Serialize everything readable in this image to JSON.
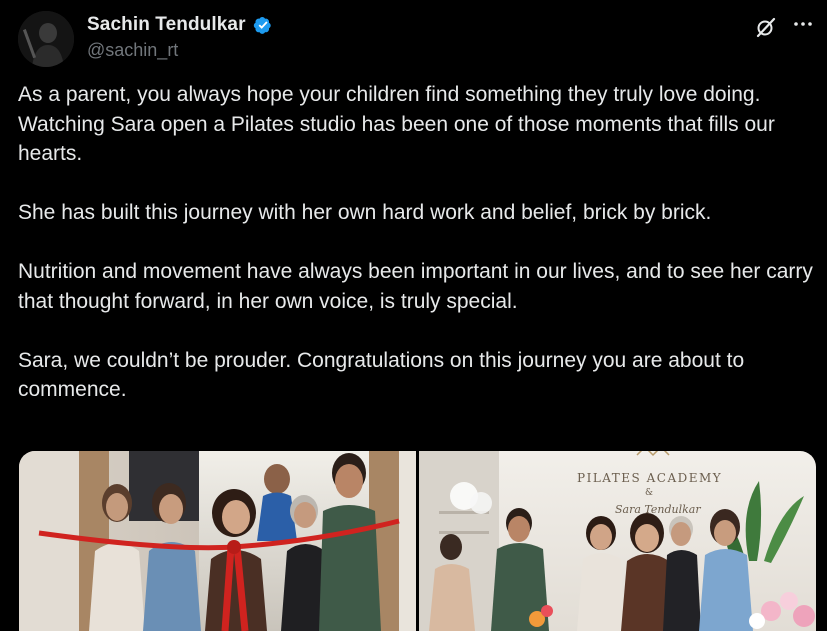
{
  "author": {
    "display_name": "Sachin Tendulkar",
    "handle": "@sachin_rt",
    "verified": true
  },
  "icons": {
    "avatar": "profile-avatar",
    "verified": "verified-badge-icon",
    "grok": "grok-icon",
    "more": "more-options-icon"
  },
  "colors": {
    "background": "#000000",
    "text": "#e7e9ea",
    "secondary_text": "#71767b",
    "verified_blue": "#1d9bf0"
  },
  "tweet": {
    "paragraphs": [
      "As a parent, you always hope your children find something they truly love doing. Watching Sara open a Pilates studio has been one of those moments that fills our hearts.",
      "She has built this journey with her own hard work and belief, brick by brick.",
      "Nutrition and movement have always been important in our lives, and to see her carry that thought forward, in her own voice, is truly special.",
      "Sara, we couldn’t be prouder. Congratulations on this journey you are about to commence."
    ]
  },
  "media": {
    "photo_2_sign_line1": "PILATES ACADEMY",
    "photo_2_sign_line2": "&",
    "photo_2_sign_line3": "Sara Tendulkar"
  }
}
